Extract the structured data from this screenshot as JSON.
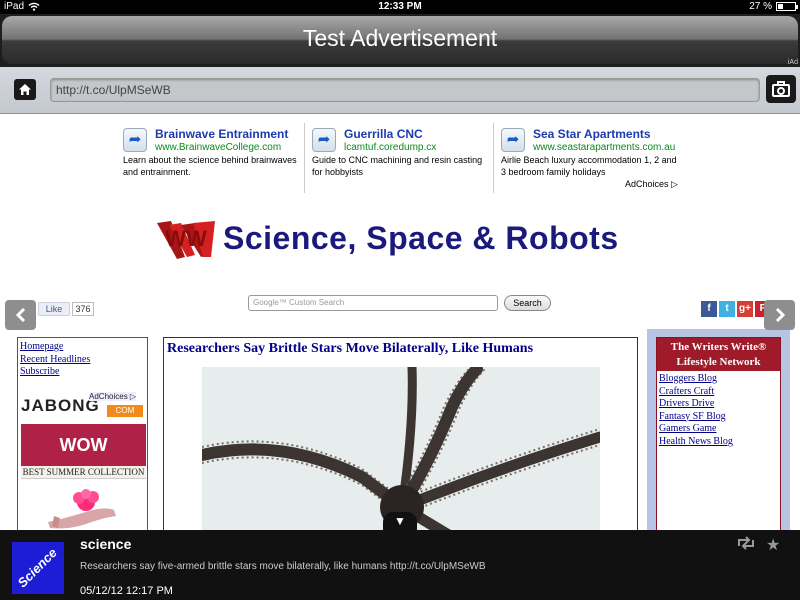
{
  "status": {
    "device": "iPad",
    "time": "12:33 PM",
    "battery": "27 %",
    "battery_level": 0.27
  },
  "ad_banner": {
    "title": "Test Advertisement",
    "iad": "iAd"
  },
  "address": {
    "url": "http://t.co/UlpMSeWB"
  },
  "ads": [
    {
      "title": "Brainwave Entrainment",
      "url": "www.BrainwaveCollege.com",
      "desc": "Learn about the science behind brainwaves and entrainment."
    },
    {
      "title": "Guerrilla CNC",
      "url": "lcamtuf.coredump.cx",
      "desc": "Guide to CNC machining and resin casting for hobbyists"
    },
    {
      "title": "Sea Star Apartments",
      "url": "www.seastarapartments.com.au",
      "desc": "Airlie Beach luxury accommodation 1, 2 and 3 bedroom family holidays"
    }
  ],
  "adchoices": "AdChoices ▷",
  "site": {
    "logo_mark": "WW",
    "title": "Science, Space & Robots"
  },
  "like": {
    "label": "Like",
    "count": "376"
  },
  "search": {
    "placeholder": "Google™ Custom Search",
    "button": "Search"
  },
  "social": [
    "f",
    "t",
    "g+",
    "P"
  ],
  "left_links": [
    "Homepage",
    "Recent Headlines",
    "Subscribe"
  ],
  "left_ad": {
    "brand": "JABONG",
    "dotcom": "COM",
    "adchoices": "AdChoices ▷",
    "banner": "WOW WEDGES",
    "tagline": "BEST SUMMER COLLECTION"
  },
  "article": {
    "headline": "Researchers Say Brittle Stars Move Bilaterally, Like Humans"
  },
  "writers": {
    "title": "The Writers Write® Lifestyle Network",
    "links": [
      "Bloggers Blog",
      "Crafters Craft",
      "Drivers Drive",
      "Fantasy SF Blog",
      "Gamers Game",
      "Health News Blog"
    ]
  },
  "tweet": {
    "handle": "science",
    "avatar_text": "Science",
    "text": "Researchers say five-armed brittle stars move bilaterally, like humans http://t.co/UlpMSeWB",
    "time": "05/12/12 12:17 PM",
    "tab_icon": "▼"
  },
  "colors": {
    "link": "#00008b",
    "ad_title": "#1c3bb0",
    "ad_url": "#0a8a1f",
    "site_title": "#1a1a7c",
    "writers_header": "#a01b2a",
    "right_panel": "#b6c5e3"
  }
}
